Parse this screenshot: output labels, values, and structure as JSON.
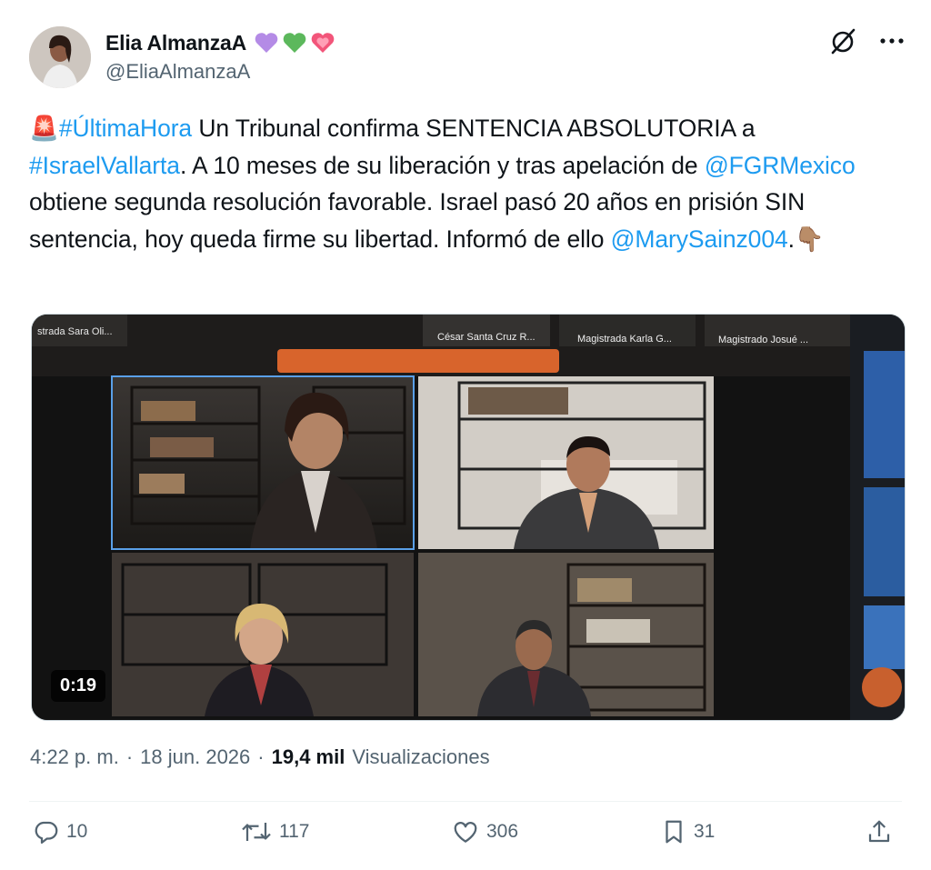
{
  "author": {
    "display_name": "Elia AlmanzaA",
    "handle": "@EliaAlmanzaA",
    "emoji_badges": [
      "purple-heart",
      "green-heart",
      "sparkling-heart"
    ]
  },
  "tweet": {
    "siren_emoji": "🚨",
    "segments": [
      {
        "text": "#ÚltimaHora",
        "link": true
      },
      {
        "text": " Un Tribunal confirma SENTENCIA ABSOLUTORIA a ",
        "link": false
      },
      {
        "text": "#IsraelVallarta",
        "link": true
      },
      {
        "text": ". A 10 meses de su liberación y tras apelación de ",
        "link": false
      },
      {
        "text": "@FGRMexico",
        "link": true
      },
      {
        "text": " obtiene segunda resolución favorable. Israel pasó 20 años en prisión SIN sentencia, hoy queda firme su libertad. Informó de ello ",
        "link": false
      },
      {
        "text": "@MarySainz004",
        "link": true
      },
      {
        "text": ".👇🏽",
        "link": false
      }
    ]
  },
  "media": {
    "duration": "0:19",
    "labels": {
      "tile_top_left": "strada Sara Oli...",
      "tile_top_1": "César Santa Cruz R...",
      "tile_top_2": "Magistrada Karla G...",
      "tile_top_3": "Magistrado Josué ..."
    }
  },
  "meta": {
    "time": "4:22 p. m.",
    "date": "18 jun. 2026",
    "views_count": "19,4 mil",
    "views_label": "Visualizaciones"
  },
  "actions": {
    "replies": "10",
    "reposts": "117",
    "likes": "306",
    "bookmarks": "31"
  },
  "colors": {
    "link": "#1d9bf0",
    "secondary_text": "#536471",
    "primary_text": "#0f1419"
  }
}
